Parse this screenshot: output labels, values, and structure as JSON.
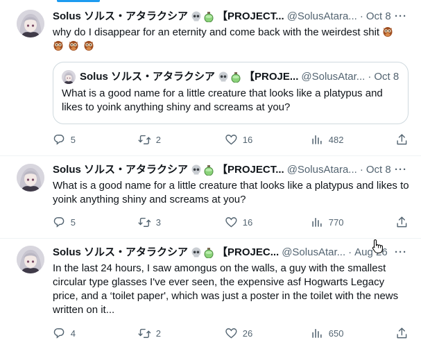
{
  "tweets": [
    {
      "name": "Solus ソルス・アタラクシア",
      "tag": "【PROJECT...",
      "handle": "@SolusAtara...",
      "date": "Oct 8",
      "emoji": [
        "skull",
        "potion"
      ],
      "text": "why do I disappear for an eternity and come back with the weirdest shit 🦉 🦉 🦉 🦉",
      "quote": {
        "name": "Solus ソルス・アタラクシア",
        "tag": "【PROJE...",
        "handle": "@SolusAtar...",
        "date": "Oct 8",
        "text": "What is a good name for a little creature that looks like a platypus and likes to yoink anything shiny and screams at you?"
      },
      "stats": {
        "replies": "5",
        "retweets": "2",
        "likes": "16",
        "views": "482"
      }
    },
    {
      "name": "Solus ソルス・アタラクシア",
      "tag": "【PROJECT...",
      "handle": "@SolusAtara...",
      "date": "Oct 8",
      "emoji": [
        "skull",
        "potion"
      ],
      "text": "What is a good name for a little creature that looks like a platypus and likes to yoink anything shiny and screams at you?",
      "stats": {
        "replies": "5",
        "retweets": "3",
        "likes": "16",
        "views": "770"
      }
    },
    {
      "name": "Solus ソルス・アタラクシア",
      "tag": "【PROJEC...",
      "handle": "@SolusAtar...",
      "date": "Aug 26",
      "emoji": [
        "skull",
        "potion"
      ],
      "text": "In the last 24 hours, I saw amongus on the walls, a guy with the smallest circular type glasses I've ever seen,  the expensive asf Hogwarts Legacy price, and a ‘toilet paper', which was just a poster in the toilet with the news written on it...",
      "stats": {
        "replies": "4",
        "retweets": "2",
        "likes": "26",
        "views": "650"
      }
    }
  ],
  "ui": {
    "more": "···",
    "sep": "·"
  },
  "icons": [
    "reply-icon",
    "retweet-icon",
    "like-icon",
    "views-icon",
    "share-icon",
    "more-icon",
    "skull-icon",
    "potion-icon",
    "owl-icon"
  ],
  "colors": {
    "text": "#0f1419",
    "muted": "#536471",
    "border": "#eff3f4",
    "quote_border": "#cfd9de",
    "accent": "#1d9bf0"
  }
}
